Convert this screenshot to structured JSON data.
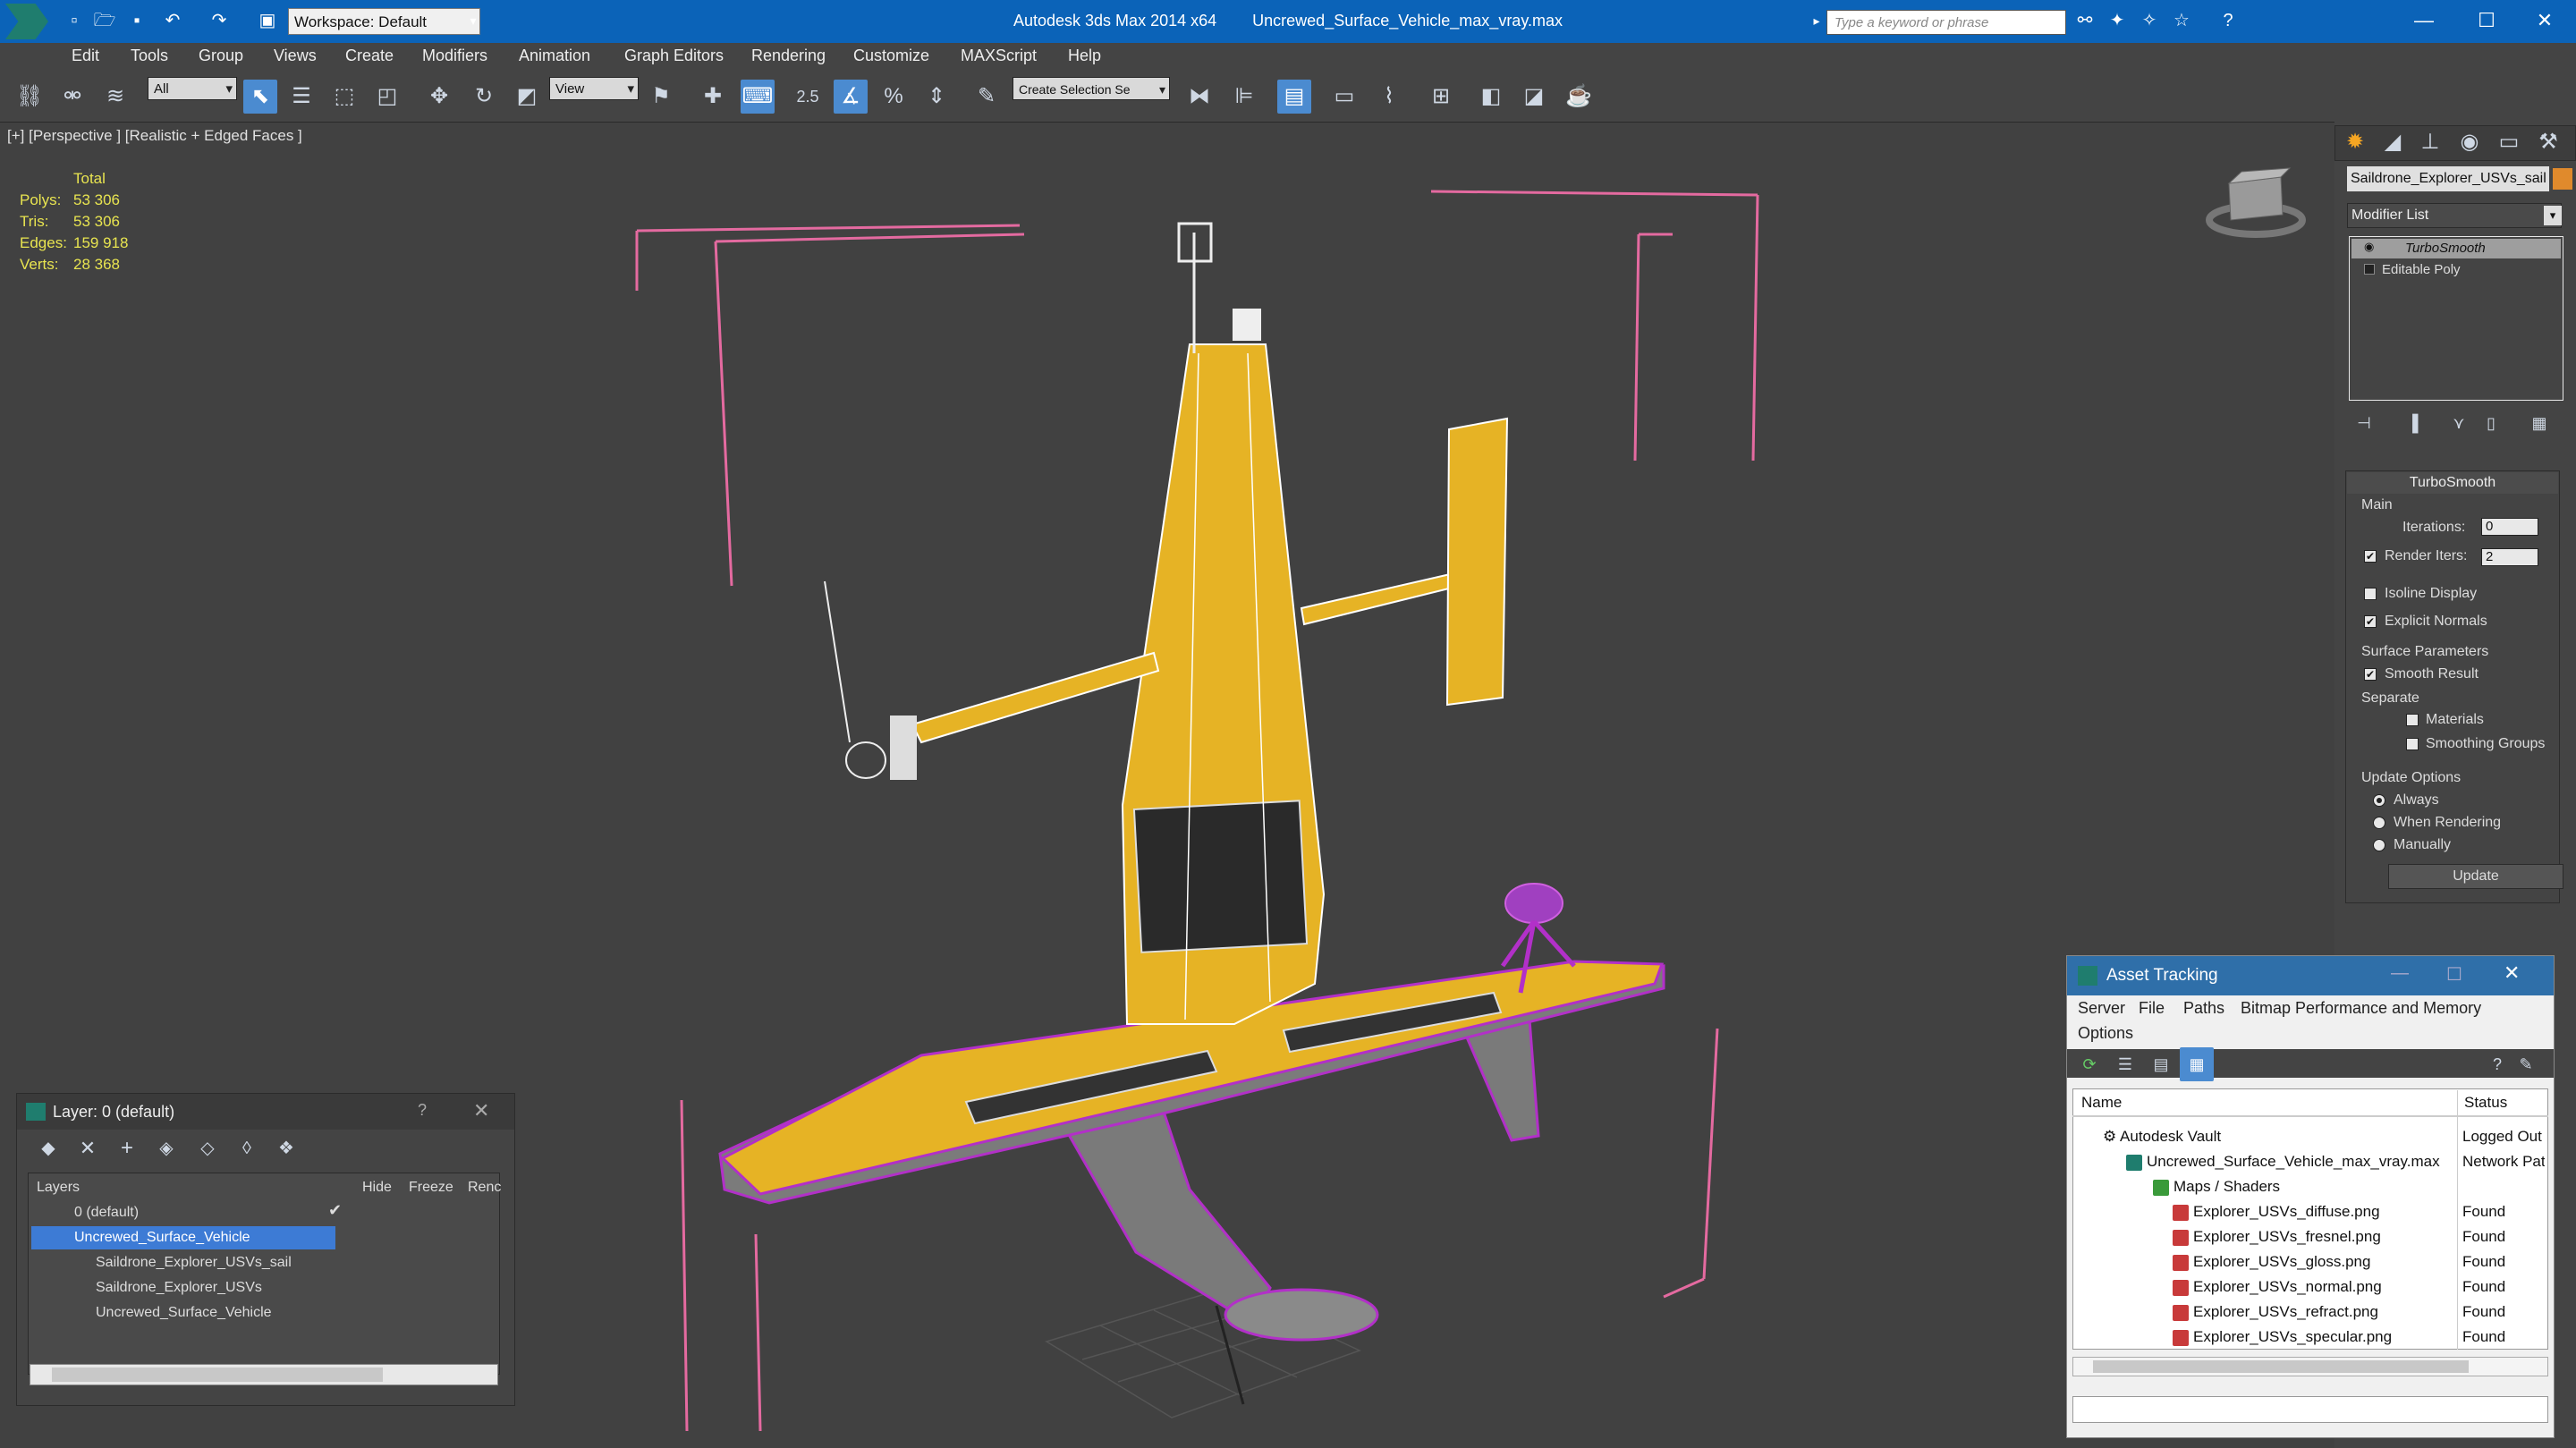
{
  "titlebar": {
    "app": "Autodesk 3ds Max  2014 x64",
    "file": "Uncrewed_Surface_Vehicle_max_vray.max",
    "workspace": "Workspace: Default",
    "search_placeholder": "Type a keyword or phrase",
    "brand_color": "#0b63b8"
  },
  "menu": [
    "Edit",
    "Tools",
    "Group",
    "Views",
    "Create",
    "Modifiers",
    "Animation",
    "Graph Editors",
    "Rendering",
    "Customize",
    "MAXScript",
    "Help"
  ],
  "toolbar": {
    "filter": "All",
    "ref_coord": "View",
    "snap_value": "2.5",
    "selection_set": "Create Selection Se"
  },
  "viewport": {
    "label": "[+] [Perspective ] [Realistic + Edged Faces ]",
    "stats": {
      "total_label": "Total",
      "rows": [
        {
          "label": "Polys:",
          "value": "53 306"
        },
        {
          "label": "Tris:",
          "value": "53 306"
        },
        {
          "label": "Edges:",
          "value": "159 918"
        },
        {
          "label": "Verts:",
          "value": "28 368"
        }
      ]
    },
    "model_color": "#e6b325",
    "wire_color": "#b230c8"
  },
  "command_panel": {
    "object_name": "Saildrone_Explorer_USVs_sail",
    "modifier_list": "Modifier List",
    "stack": [
      "TurboSmooth",
      "Editable Poly"
    ],
    "rollout_title": "TurboSmooth",
    "main_label": "Main",
    "iterations_label": "Iterations:",
    "iterations": "0",
    "render_iters_label": "Render Iters:",
    "render_iters": "2",
    "isoline": "Isoline Display",
    "explicit": "Explicit Normals",
    "surface_params": "Surface Parameters",
    "smooth_result": "Smooth Result",
    "separate": "Separate",
    "materials": "Materials",
    "smoothing_groups": "Smoothing Groups",
    "update_options": "Update Options",
    "always": "Always",
    "when_rendering": "When Rendering",
    "manually": "Manually",
    "update_button": "Update"
  },
  "layer_panel": {
    "title": "Layer: 0 (default)",
    "help": "?",
    "columns": [
      "Layers",
      "Hide",
      "Freeze",
      "Renc"
    ],
    "rows": [
      {
        "name": "0 (default)",
        "indent": 0
      },
      {
        "name": "Uncrewed_Surface_Vehicle",
        "indent": 0,
        "selected": true
      },
      {
        "name": "Saildrone_Explorer_USVs_sail",
        "indent": 1
      },
      {
        "name": "Saildrone_Explorer_USVs",
        "indent": 1
      },
      {
        "name": "Uncrewed_Surface_Vehicle",
        "indent": 1
      }
    ]
  },
  "asset_panel": {
    "title": "Asset Tracking",
    "menus": [
      "Server",
      "File",
      "Paths",
      "Bitmap Performance and Memory",
      "Options"
    ],
    "columns": [
      "Name",
      "Status"
    ],
    "rows": [
      {
        "name": "Autodesk Vault",
        "status": "Logged Out"
      },
      {
        "name": "Uncrewed_Surface_Vehicle_max_vray.max",
        "status": "Network Pat"
      },
      {
        "name": "Maps / Shaders",
        "status": ""
      },
      {
        "name": "Explorer_USVs_diffuse.png",
        "status": "Found"
      },
      {
        "name": "Explorer_USVs_fresnel.png",
        "status": "Found"
      },
      {
        "name": "Explorer_USVs_gloss.png",
        "status": "Found"
      },
      {
        "name": "Explorer_USVs_normal.png",
        "status": "Found"
      },
      {
        "name": "Explorer_USVs_refract.png",
        "status": "Found"
      },
      {
        "name": "Explorer_USVs_specular.png",
        "status": "Found"
      }
    ]
  }
}
